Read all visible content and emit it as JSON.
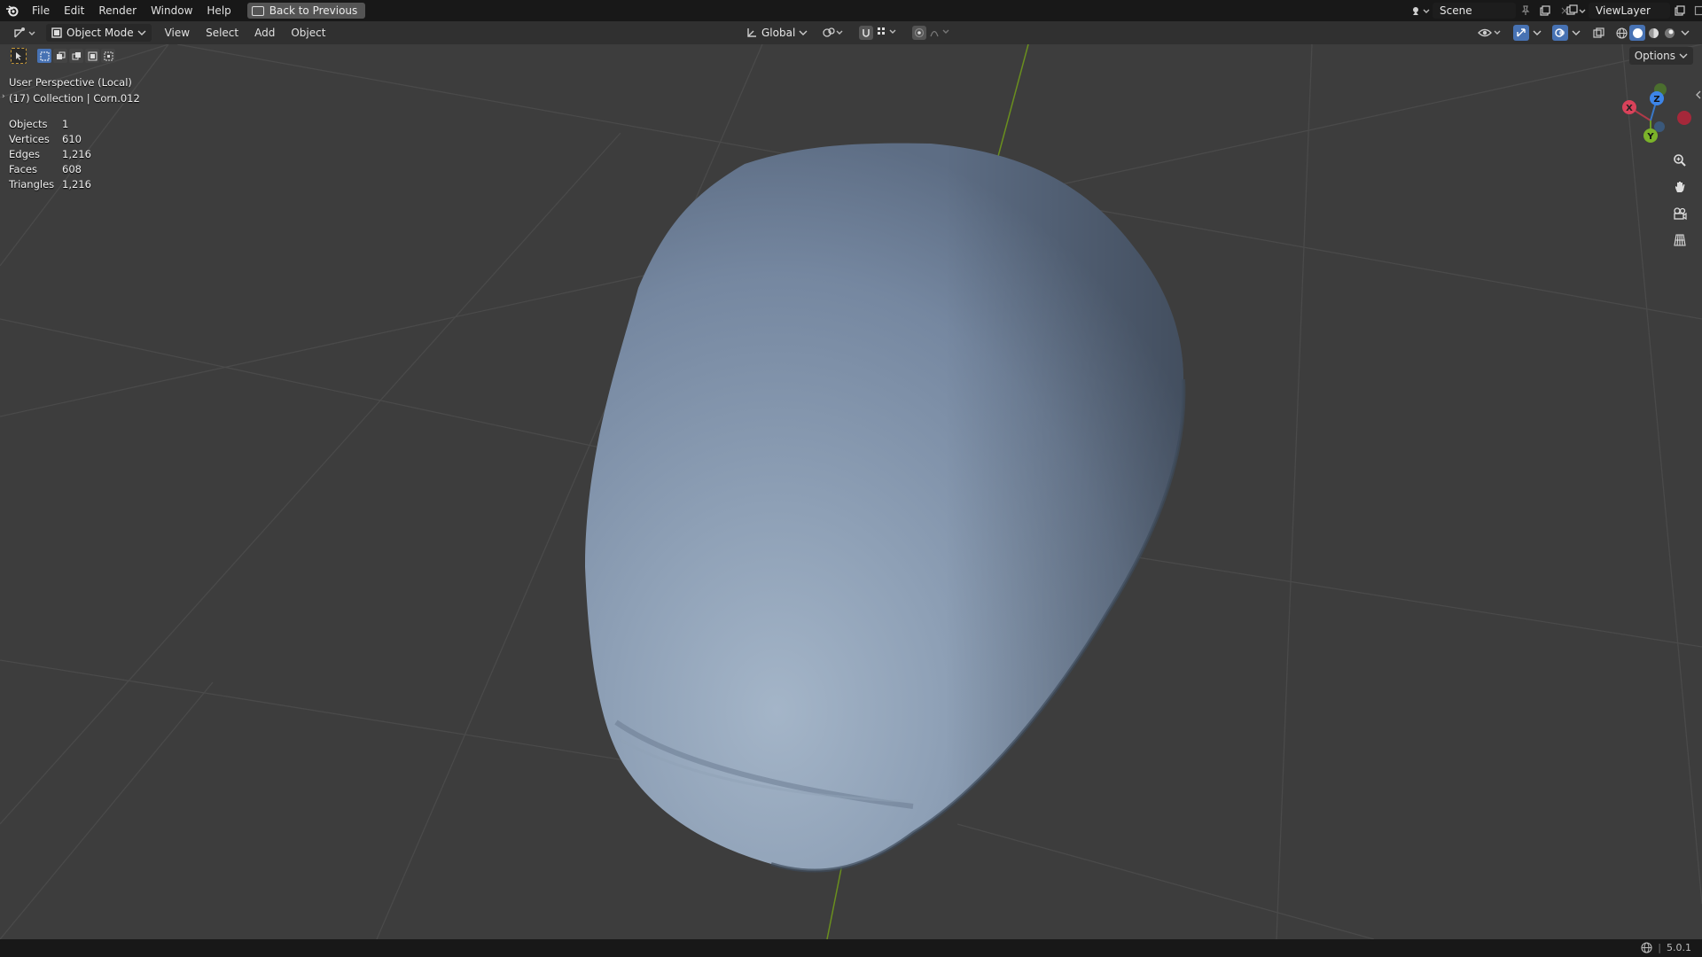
{
  "topbar": {
    "menu": [
      "File",
      "Edit",
      "Render",
      "Window",
      "Help"
    ],
    "back_button": "Back to Previous",
    "scene_name": "Scene",
    "viewlayer_name": "ViewLayer"
  },
  "header": {
    "mode": "Object Mode",
    "menu": [
      "View",
      "Select",
      "Add",
      "Object"
    ],
    "transform_orientation": "Global",
    "options_label": "Options"
  },
  "viewport": {
    "perspective": "User Perspective (Local)",
    "collection": "(17) Collection | Corn.012",
    "stats": [
      {
        "label": "Objects",
        "value": "1"
      },
      {
        "label": "Vertices",
        "value": "610"
      },
      {
        "label": "Edges",
        "value": "1,216"
      },
      {
        "label": "Faces",
        "value": "608"
      },
      {
        "label": "Triangles",
        "value": "1,216"
      }
    ],
    "gizmo_axes": [
      "X",
      "Z",
      "Y"
    ],
    "mesh_color": "#8497ad"
  },
  "statusbar": {
    "version": "5.0.1"
  }
}
